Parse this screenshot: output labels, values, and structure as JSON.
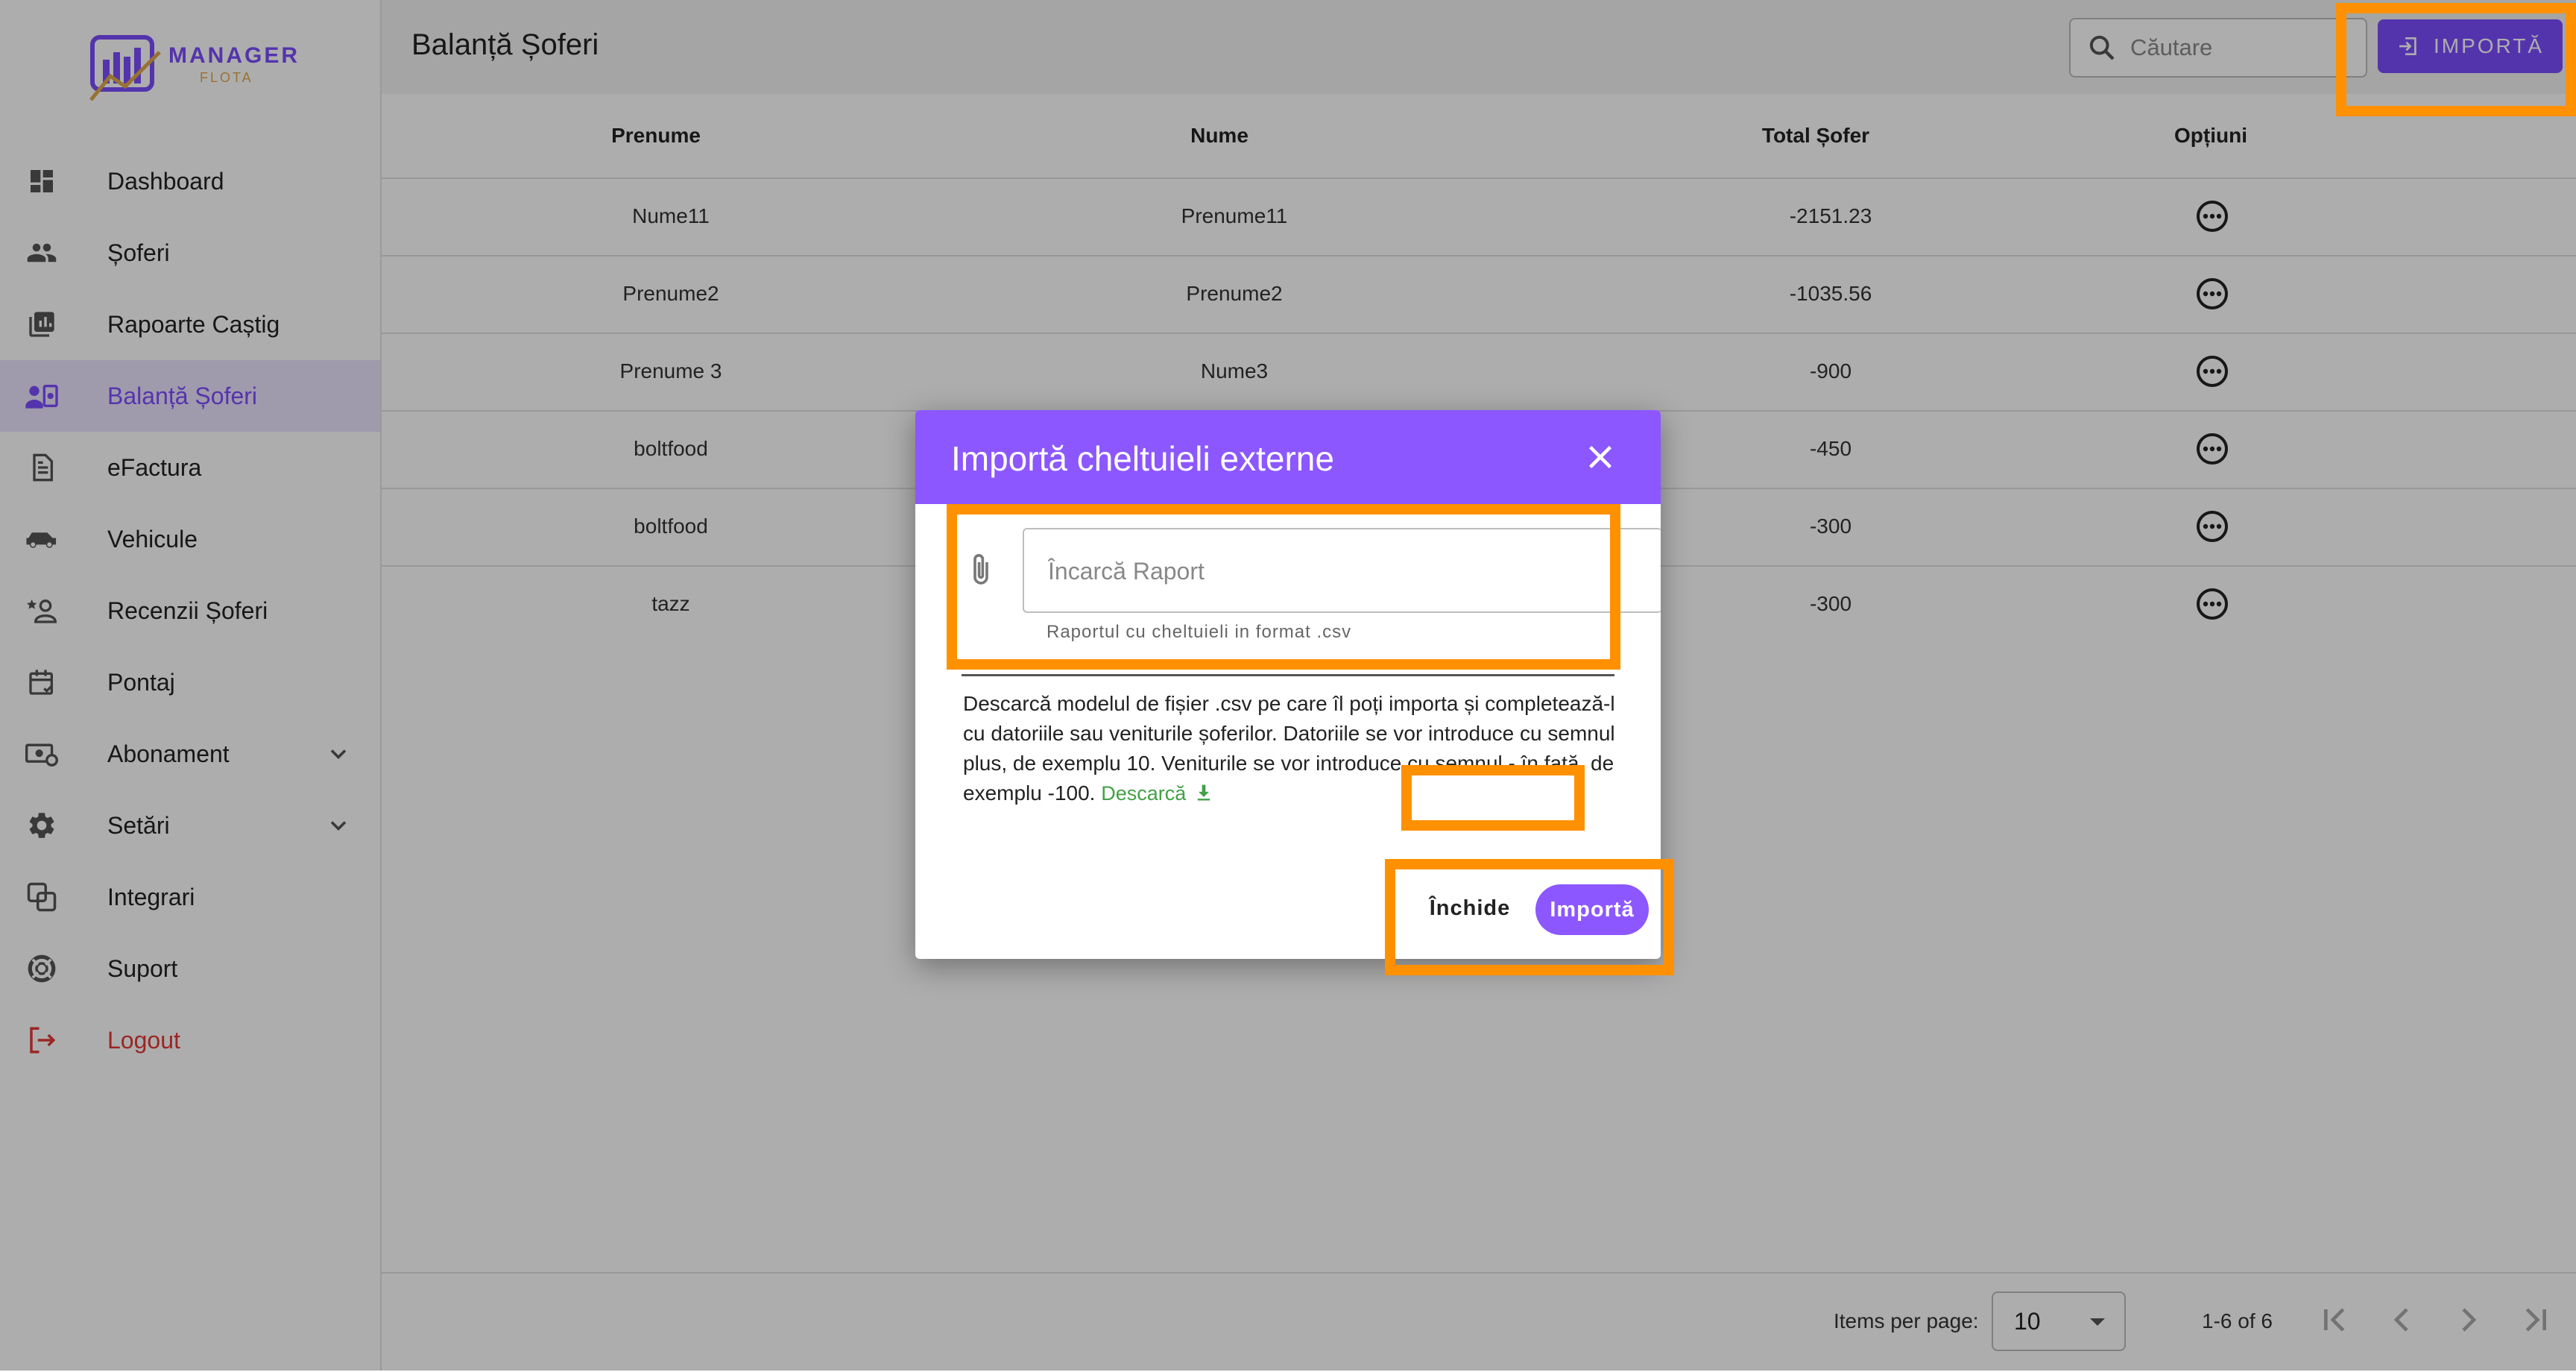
{
  "app": {
    "logo_text_top": "MANAGER",
    "logo_text_bottom": "FLOTA"
  },
  "sidebar": {
    "items": [
      {
        "label": "Dashboard",
        "icon": "dashboard-icon"
      },
      {
        "label": "Șoferi",
        "icon": "people-icon"
      },
      {
        "label": "Rapoarte Caștig",
        "icon": "report-icon"
      },
      {
        "label": "Balanță Șoferi",
        "icon": "balance-icon",
        "active": true
      },
      {
        "label": "eFactura",
        "icon": "document-icon"
      },
      {
        "label": "Vehicule",
        "icon": "car-icon"
      },
      {
        "label": "Recenzii Șoferi",
        "icon": "review-icon"
      },
      {
        "label": "Pontaj",
        "icon": "calendar-icon"
      },
      {
        "label": "Abonament",
        "icon": "money-icon",
        "expandable": true
      },
      {
        "label": "Setări",
        "icon": "gear-icon",
        "expandable": true
      },
      {
        "label": "Integrari",
        "icon": "integration-icon"
      },
      {
        "label": "Suport",
        "icon": "support-icon"
      },
      {
        "label": "Logout",
        "icon": "logout-icon"
      }
    ]
  },
  "header": {
    "title": "Balanță Șoferi",
    "search_placeholder": "Căutare",
    "import_label": "IMPORTĂ"
  },
  "table": {
    "columns": [
      "Prenume",
      "Nume",
      "Total Șofer",
      "Opțiuni"
    ],
    "rows": [
      {
        "prenume": "Nume11",
        "nume": "Prenume11",
        "total": "-2151.23"
      },
      {
        "prenume": "Prenume2",
        "nume": "Prenume2",
        "total": "-1035.56"
      },
      {
        "prenume": "Prenume 3",
        "nume": "Nume3",
        "total": "-900"
      },
      {
        "prenume": "boltfood",
        "nume": "",
        "total": "-450"
      },
      {
        "prenume": "boltfood",
        "nume": "",
        "total": "-300"
      },
      {
        "prenume": "tazz",
        "nume": "",
        "total": "-300"
      }
    ]
  },
  "footer": {
    "items_per_page_label": "Items per page:",
    "items_per_page_value": "10",
    "range_label": "1-6 of 6"
  },
  "dialog": {
    "title": "Importă cheltuieli externe",
    "file_placeholder": "Încarcă Raport",
    "file_hint": "Raportul cu cheltuieli in format .csv",
    "description": "Descarcă modelul de fișier .csv pe care îl poți importa și completează-l cu datoriile sau veniturile șoferilor. Datoriile se vor introduce cu semnul plus, de exemplu 10. Veniturile se vor introduce cu semnul - în față, de exemplu -100.",
    "download_label": "Descarcă",
    "close_label": "Închide",
    "import_label": "Importă"
  },
  "colors": {
    "accent": "#8c57ff",
    "highlight": "#ff9100",
    "download": "#43a047",
    "logout": "#e53935"
  }
}
